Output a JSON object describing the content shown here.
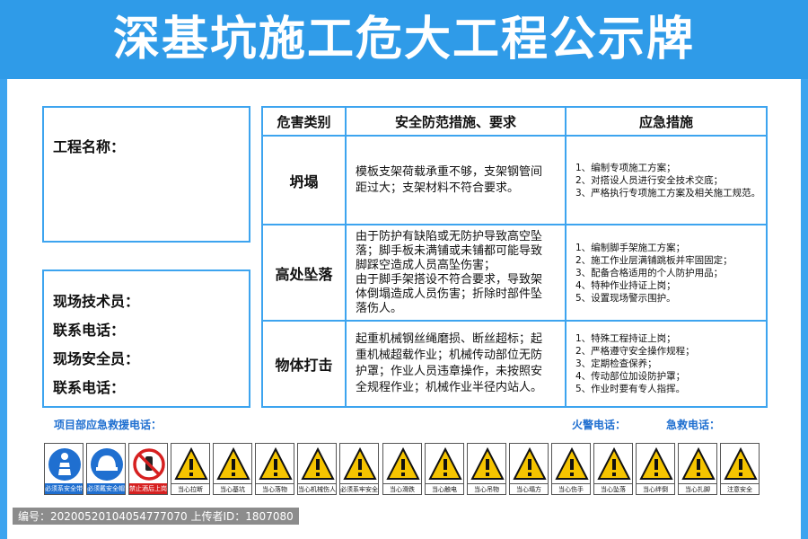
{
  "title": "深基坑施工危大工程公示牌",
  "project": {
    "name_label": "工程名称："
  },
  "contacts": [
    "现场技术员：",
    "联系电话：",
    "现场安全员：",
    "联系电话："
  ],
  "table": {
    "headers": [
      "危害类别",
      "安全防范措施、要求",
      "应急措施"
    ],
    "rows": [
      {
        "category": "坍塌",
        "requirements": [
          "模板支架荷载承重不够，支架钢管间",
          "距过大；支架材料不符合要求。"
        ],
        "emergency": [
          "1、编制专项施工方案；",
          "2、对搭设人员进行安全技术交底；",
          "3、严格执行专项施工方案及相关施工规范。"
        ]
      },
      {
        "category": "高处坠落",
        "requirements": [
          "由于防护有缺陷或无防护导致高空坠",
          "落；脚手板未满铺或未铺都可能导致",
          "脚踩空造成人员高坠伤害；",
          "由于脚手架搭设不符合要求，导致架",
          "体倒塌造成人员伤害；折除时部件坠",
          "落伤人。"
        ],
        "emergency": [
          "1、编制脚手架施工方案；",
          "2、施工作业层满铺跳板并牢固固定；",
          "3、配备合格适用的个人防护用品；",
          "4、特种作业持证上岗；",
          "5、设置现场警示围护。"
        ]
      },
      {
        "category": "物体打击",
        "requirements": [
          "起重机械钢丝绳磨损、断丝超标；起",
          "重机械超载作业；机械传动部位无防",
          "护罩；作业人员违章操作，未按照安",
          "全规程作业；机械作业半径内站人。"
        ],
        "emergency": [
          "1、特殊工程持证上岗；",
          "2、严格遵守安全操作规程；",
          "3、定期检查保养；",
          "4、传动部位加设防护罩；",
          "5、作业时要有专人指挥。"
        ]
      }
    ]
  },
  "footer": {
    "rescue_label": "项目部应急救援电话：",
    "fire_label": "火警电话：",
    "ambulance_label": "急救电话："
  },
  "signs": [
    {
      "caption": "必须系安全带",
      "kind": "blue",
      "icon": "safety-belt-icon"
    },
    {
      "caption": "必须戴安全帽",
      "kind": "blue",
      "icon": "helmet-icon"
    },
    {
      "caption": "禁止酒后上岗",
      "kind": "red",
      "icon": "no-alcohol-icon"
    },
    {
      "caption": "当心拉断",
      "kind": "yel",
      "icon": "warning-triangle-icon"
    },
    {
      "caption": "当心基坑",
      "kind": "yel",
      "icon": "warning-triangle-icon"
    },
    {
      "caption": "当心落物",
      "kind": "yel",
      "icon": "warning-triangle-icon"
    },
    {
      "caption": "当心机械伤人",
      "kind": "yel",
      "icon": "warning-triangle-icon"
    },
    {
      "caption": "必须系牢安全锁",
      "kind": "yel",
      "icon": "warning-triangle-icon"
    },
    {
      "caption": "当心滑跌",
      "kind": "yel",
      "icon": "warning-triangle-icon"
    },
    {
      "caption": "当心触电",
      "kind": "yel",
      "icon": "warning-triangle-icon"
    },
    {
      "caption": "当心吊物",
      "kind": "yel",
      "icon": "warning-triangle-icon"
    },
    {
      "caption": "当心塌方",
      "kind": "yel",
      "icon": "warning-triangle-icon"
    },
    {
      "caption": "当心伤手",
      "kind": "yel",
      "icon": "warning-triangle-icon"
    },
    {
      "caption": "当心坠落",
      "kind": "yel",
      "icon": "warning-triangle-icon"
    },
    {
      "caption": "当心绊倒",
      "kind": "yel",
      "icon": "warning-triangle-icon"
    },
    {
      "caption": "当心扎脚",
      "kind": "yel",
      "icon": "warning-triangle-icon"
    },
    {
      "caption": "注意安全",
      "kind": "yel",
      "icon": "warning-triangle-icon"
    }
  ],
  "watermark": "编号：20200520104054777070 上传者ID：1807080",
  "colors": {
    "banner": "#2f9be8",
    "border": "#3da4ef",
    "footer_text": "#1f6fd0"
  }
}
